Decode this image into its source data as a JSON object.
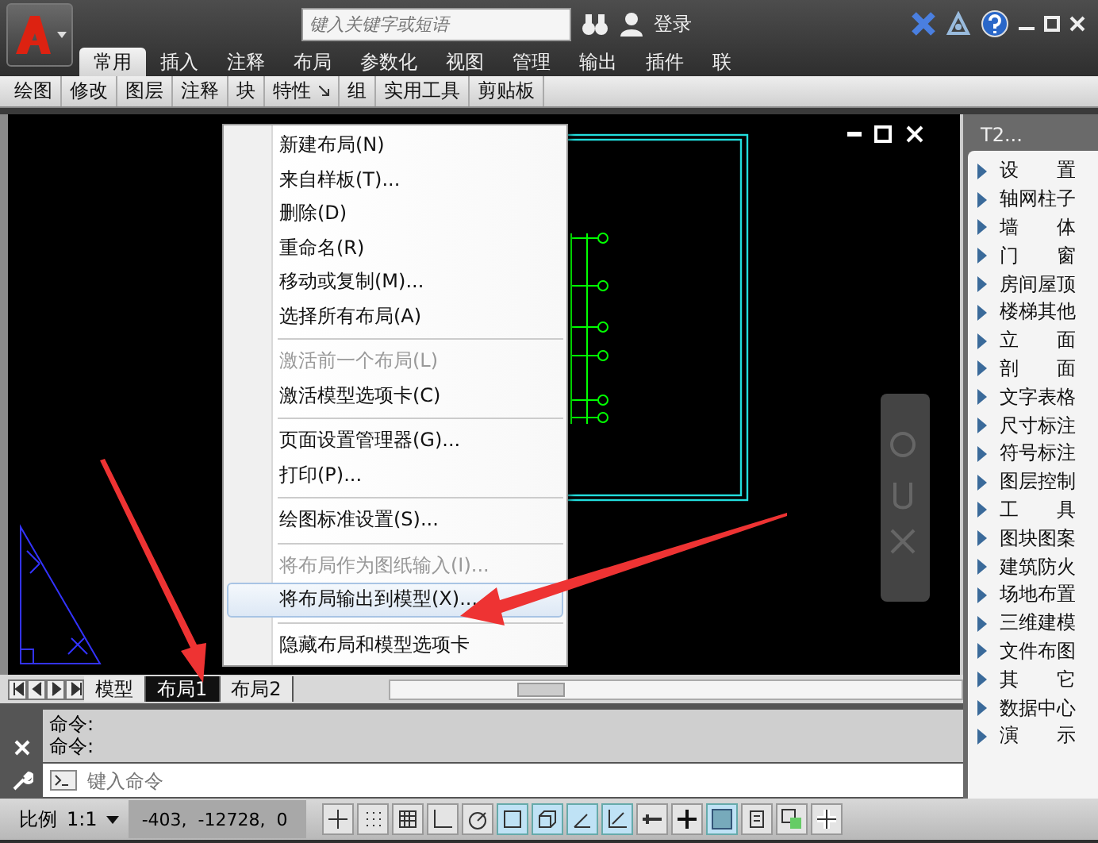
{
  "title_bar": {
    "search": {
      "placeholder": "键入关键字或短语"
    },
    "login": "登录"
  },
  "ribbon": {
    "tabs": [
      {
        "label": "常用",
        "selected": true
      },
      {
        "label": "插入",
        "selected": false
      },
      {
        "label": "注释",
        "selected": false
      },
      {
        "label": "布局",
        "selected": false
      },
      {
        "label": "参数化",
        "selected": false
      },
      {
        "label": "视图",
        "selected": false
      },
      {
        "label": "管理",
        "selected": false
      },
      {
        "label": "输出",
        "selected": false
      },
      {
        "label": "插件",
        "selected": false
      },
      {
        "label": "联",
        "selected": false
      }
    ],
    "panels": [
      {
        "label": "绘图",
        "launcher": false
      },
      {
        "label": "修改",
        "launcher": false
      },
      {
        "label": "图层",
        "launcher": false
      },
      {
        "label": "注释",
        "launcher": false
      },
      {
        "label": "块",
        "launcher": false
      },
      {
        "label": "特性",
        "launcher": true
      },
      {
        "label": "组",
        "launcher": false
      },
      {
        "label": "实用工具",
        "launcher": false
      },
      {
        "label": "剪贴板",
        "launcher": false
      }
    ]
  },
  "context_menu": {
    "groups": [
      [
        {
          "label": "新建布局(N)",
          "disabled": false,
          "highlighted": false
        },
        {
          "label": "来自样板(T)...",
          "disabled": false,
          "highlighted": false
        },
        {
          "label": "删除(D)",
          "disabled": false,
          "highlighted": false
        },
        {
          "label": "重命名(R)",
          "disabled": false,
          "highlighted": false
        },
        {
          "label": "移动或复制(M)...",
          "disabled": false,
          "highlighted": false
        },
        {
          "label": "选择所有布局(A)",
          "disabled": false,
          "highlighted": false
        }
      ],
      [
        {
          "label": "激活前一个布局(L)",
          "disabled": true,
          "highlighted": false
        },
        {
          "label": "激活模型选项卡(C)",
          "disabled": false,
          "highlighted": false
        }
      ],
      [
        {
          "label": "页面设置管理器(G)...",
          "disabled": false,
          "highlighted": false
        },
        {
          "label": "打印(P)...",
          "disabled": false,
          "highlighted": false
        }
      ],
      [
        {
          "label": "绘图标准设置(S)...",
          "disabled": false,
          "highlighted": false
        }
      ],
      [
        {
          "label": "将布局作为图纸输入(I)...",
          "disabled": true,
          "highlighted": false
        },
        {
          "label": "将布局输出到模型(X)...",
          "disabled": false,
          "highlighted": true
        }
      ],
      [
        {
          "label": "隐藏布局和模型选项卡",
          "disabled": false,
          "highlighted": false
        }
      ]
    ]
  },
  "palette": {
    "title": "T2...",
    "items": [
      "设 置",
      "轴网柱子",
      "墙 体",
      "门 窗",
      "房间屋顶",
      "楼梯其他",
      "立 面",
      "剖 面",
      "文字表格",
      "尺寸标注",
      "符号标注",
      "图层控制",
      "工 具",
      "图块图案",
      "建筑防火",
      "场地布置",
      "三维建模",
      "文件布图",
      "其 它",
      "数据中心",
      "演示"
    ]
  },
  "layout_tabs": [
    {
      "label": "模型",
      "selected": false
    },
    {
      "label": "布局1",
      "selected": true
    },
    {
      "label": "布局2",
      "selected": false
    }
  ],
  "command_history": [
    "命令:",
    "命令:"
  ],
  "command_input": {
    "placeholder": "键入命令"
  },
  "status_bar": {
    "scale_label": "比例",
    "scale": "1:1",
    "coordinates": "-403,  -12728,  0"
  }
}
